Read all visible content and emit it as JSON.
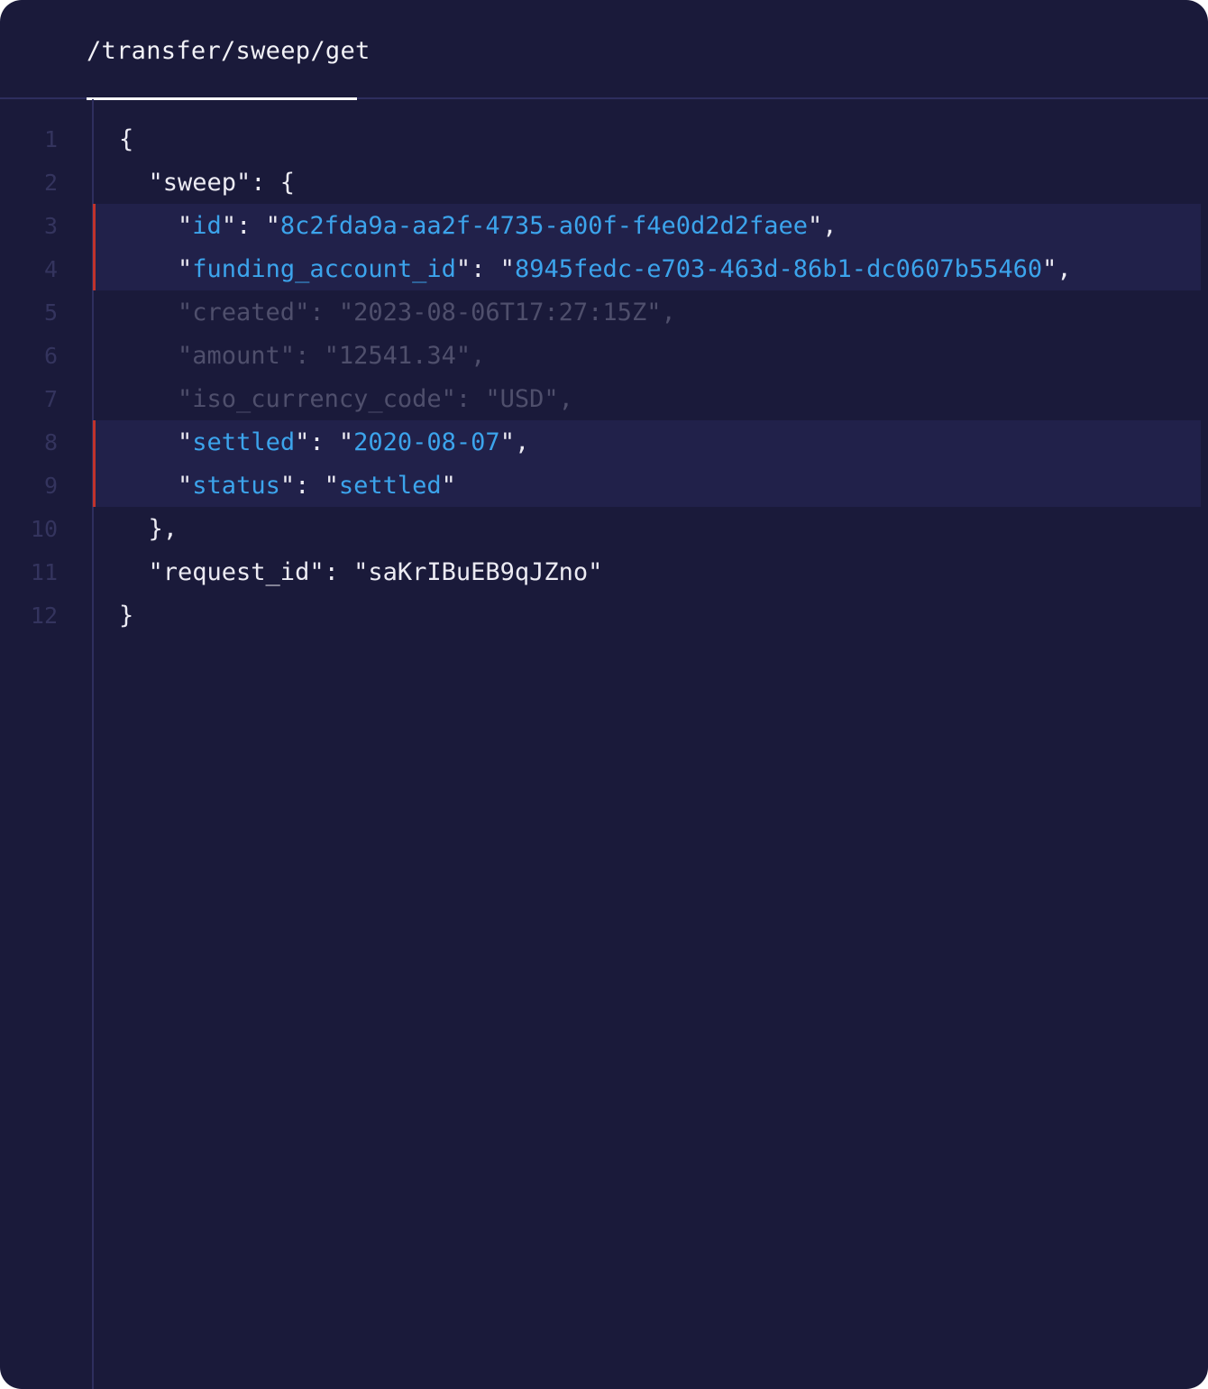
{
  "tab": {
    "label": "/transfer/sweep/get"
  },
  "lines": [
    {
      "num": "1",
      "text": "{"
    },
    {
      "num": "2",
      "text": "  \"sweep\": {"
    },
    {
      "num": "3",
      "indent": "    ",
      "key": "id",
      "value": "8c2fda9a-aa2f-4735-a00f-f4e0d2d2faee",
      "trail": "\","
    },
    {
      "num": "4",
      "indent": "    ",
      "key": "funding_account_id",
      "value": "8945fedc-e703-463d-86b1-dc0607b55460",
      "trail": "\","
    },
    {
      "num": "5",
      "text": "    \"created\": \"2023-08-06T17:27:15Z\","
    },
    {
      "num": "6",
      "text": "    \"amount\": \"12541.34\","
    },
    {
      "num": "7",
      "text": "    \"iso_currency_code\": \"USD\","
    },
    {
      "num": "8",
      "indent": "    ",
      "key": "settled",
      "value": "2020-08-07",
      "trail": "\","
    },
    {
      "num": "9",
      "indent": "    ",
      "key": "status",
      "value": "settled",
      "trail": "\""
    },
    {
      "num": "10",
      "text": "  },"
    },
    {
      "num": "11",
      "text": "  \"request_id\": \"saKrIBuEB9qJZno\""
    },
    {
      "num": "12",
      "text": "}"
    }
  ],
  "colors": {
    "background": "#1a1a3a",
    "highlight": "#21214a",
    "highlight_bar": "#c0332c",
    "key_value_accent": "#3ca4ec",
    "dimmed_text": "#4f4f6c",
    "line_number": "#34345e",
    "text": "#ecebf3"
  }
}
